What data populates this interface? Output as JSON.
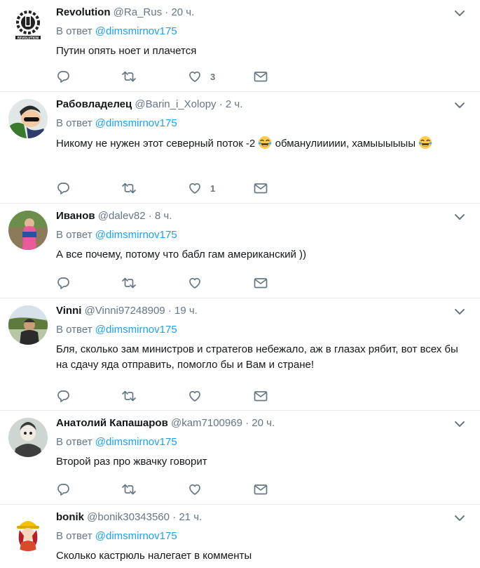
{
  "tweets": [
    {
      "fullname": "Revolution",
      "handle": "@Ra_Rus",
      "time": "20 ч.",
      "reply_prefix": "В ответ",
      "reply_to": "@dimsmirnov175",
      "text": "Путин опять ноет и плачется",
      "likes": "3",
      "avatar_icon": "revolution-fist-logo",
      "avatar_text": "REVOLUTION"
    },
    {
      "fullname": "Рабовладелец",
      "handle": "@Barin_i_Xolopy",
      "time": "2 ч.",
      "reply_prefix": "В ответ",
      "reply_to": "@dimsmirnov175",
      "text_parts": [
        "Никому не нужен этот северный поток -2 ",
        " обманулиииии, хамыыыыыы"
      ],
      "likes": "1",
      "avatar_icon": "cartoon-character"
    },
    {
      "fullname": "Иванов",
      "handle": "@dalev82",
      "time": "8 ч.",
      "reply_prefix": "В ответ",
      "reply_to": "@dimsmirnov175",
      "text": "А все почему, потому что бабл гам американский ))",
      "likes": "",
      "avatar_icon": "person-photo"
    },
    {
      "fullname": "Vinni",
      "handle": "@Vinni97248909",
      "time": "19 ч.",
      "reply_prefix": "В ответ",
      "reply_to": "@dimsmirnov175",
      "text": "Бля, сколько зам министров и стратегов небежало, аж в глазах рябит, вот всех бы на сдачу яда отправить, помогло бы и Вам и стране!",
      "likes": "",
      "avatar_icon": "person-photo"
    },
    {
      "fullname": "Анатолий Капашаров",
      "handle": "@kam7100969",
      "time": "20 ч.",
      "reply_prefix": "В ответ",
      "reply_to": "@dimsmirnov175",
      "text": "Второй раз про жвачку говорит",
      "likes": "",
      "avatar_icon": "person-photo"
    },
    {
      "fullname": "bonik",
      "handle": "@bonik30343560",
      "time": "21 ч.",
      "reply_prefix": "В ответ",
      "reply_to": "@dimsmirnov175",
      "text": "Сколько кастрюль налегает в комменты",
      "likes": "",
      "avatar_icon": "cartoon-girl-with-hard-hat"
    }
  ],
  "dot": "·",
  "colors": {
    "link": "#1da1f2",
    "secondary": "#657786",
    "border": "#e6ecf0",
    "primary": "#14171a"
  },
  "icons": [
    "reply-icon",
    "retweet-icon",
    "like-icon",
    "direct-message-icon",
    "chevron-down-icon",
    "tears-of-joy-emoji"
  ]
}
